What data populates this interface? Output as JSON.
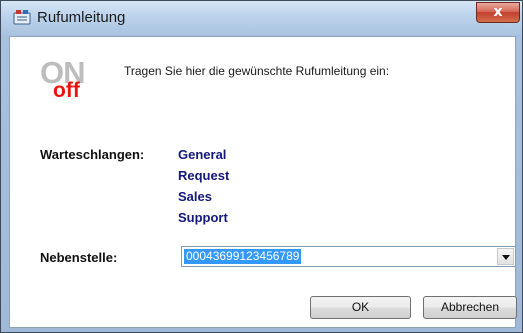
{
  "window": {
    "title": "Rufumleitung",
    "close_label": "x",
    "app_icon": "phone-redirect-icon"
  },
  "logo": {
    "on": "ON",
    "off": "off",
    "on_color": "#bdbdbd",
    "off_color": "#e8140e"
  },
  "instruction": "Tragen Sie hier die gewünschte Rufumleitung ein:",
  "queues": {
    "label": "Warteschlangen:",
    "items": [
      "General",
      "Request",
      "Sales",
      "Support"
    ],
    "item_color": "#14187a"
  },
  "extension": {
    "label": "Nebenstelle:",
    "value": "00043699123456789",
    "selection_color": "#3399ff"
  },
  "buttons": {
    "ok": "OK",
    "cancel": "Abbrechen"
  }
}
